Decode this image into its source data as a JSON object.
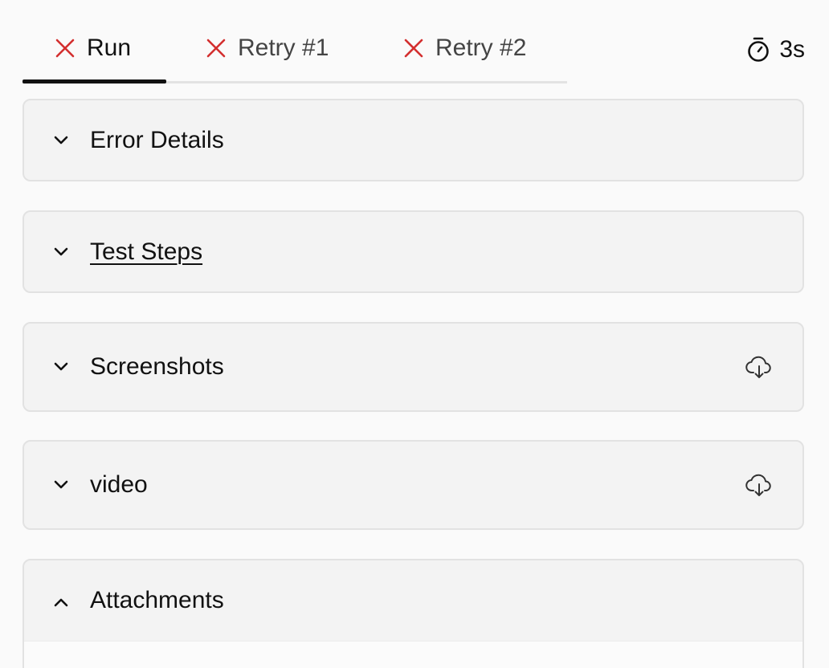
{
  "tabs": [
    {
      "label": "Run",
      "status": "failed",
      "active": true
    },
    {
      "label": "Retry #1",
      "status": "failed",
      "active": false
    },
    {
      "label": "Retry #2",
      "status": "failed",
      "active": false
    }
  ],
  "duration": {
    "value": "3s",
    "icon": "stopwatch-icon"
  },
  "panels": {
    "error_details": {
      "title": "Error Details",
      "expanded": false
    },
    "test_steps": {
      "title": "Test Steps",
      "expanded": false
    },
    "screenshots": {
      "title": "Screenshots",
      "expanded": false,
      "action_icon": "cloud-download-icon"
    },
    "video": {
      "title": "video",
      "expanded": false,
      "action_icon": "cloud-download-icon"
    },
    "attachments": {
      "title": "Attachments",
      "expanded": true
    }
  },
  "colors": {
    "failed": "#d32f2f",
    "text": "#111111",
    "panel_bg": "#f3f3f3",
    "panel_border": "#e2e2e2",
    "active_underline": "#111111"
  }
}
